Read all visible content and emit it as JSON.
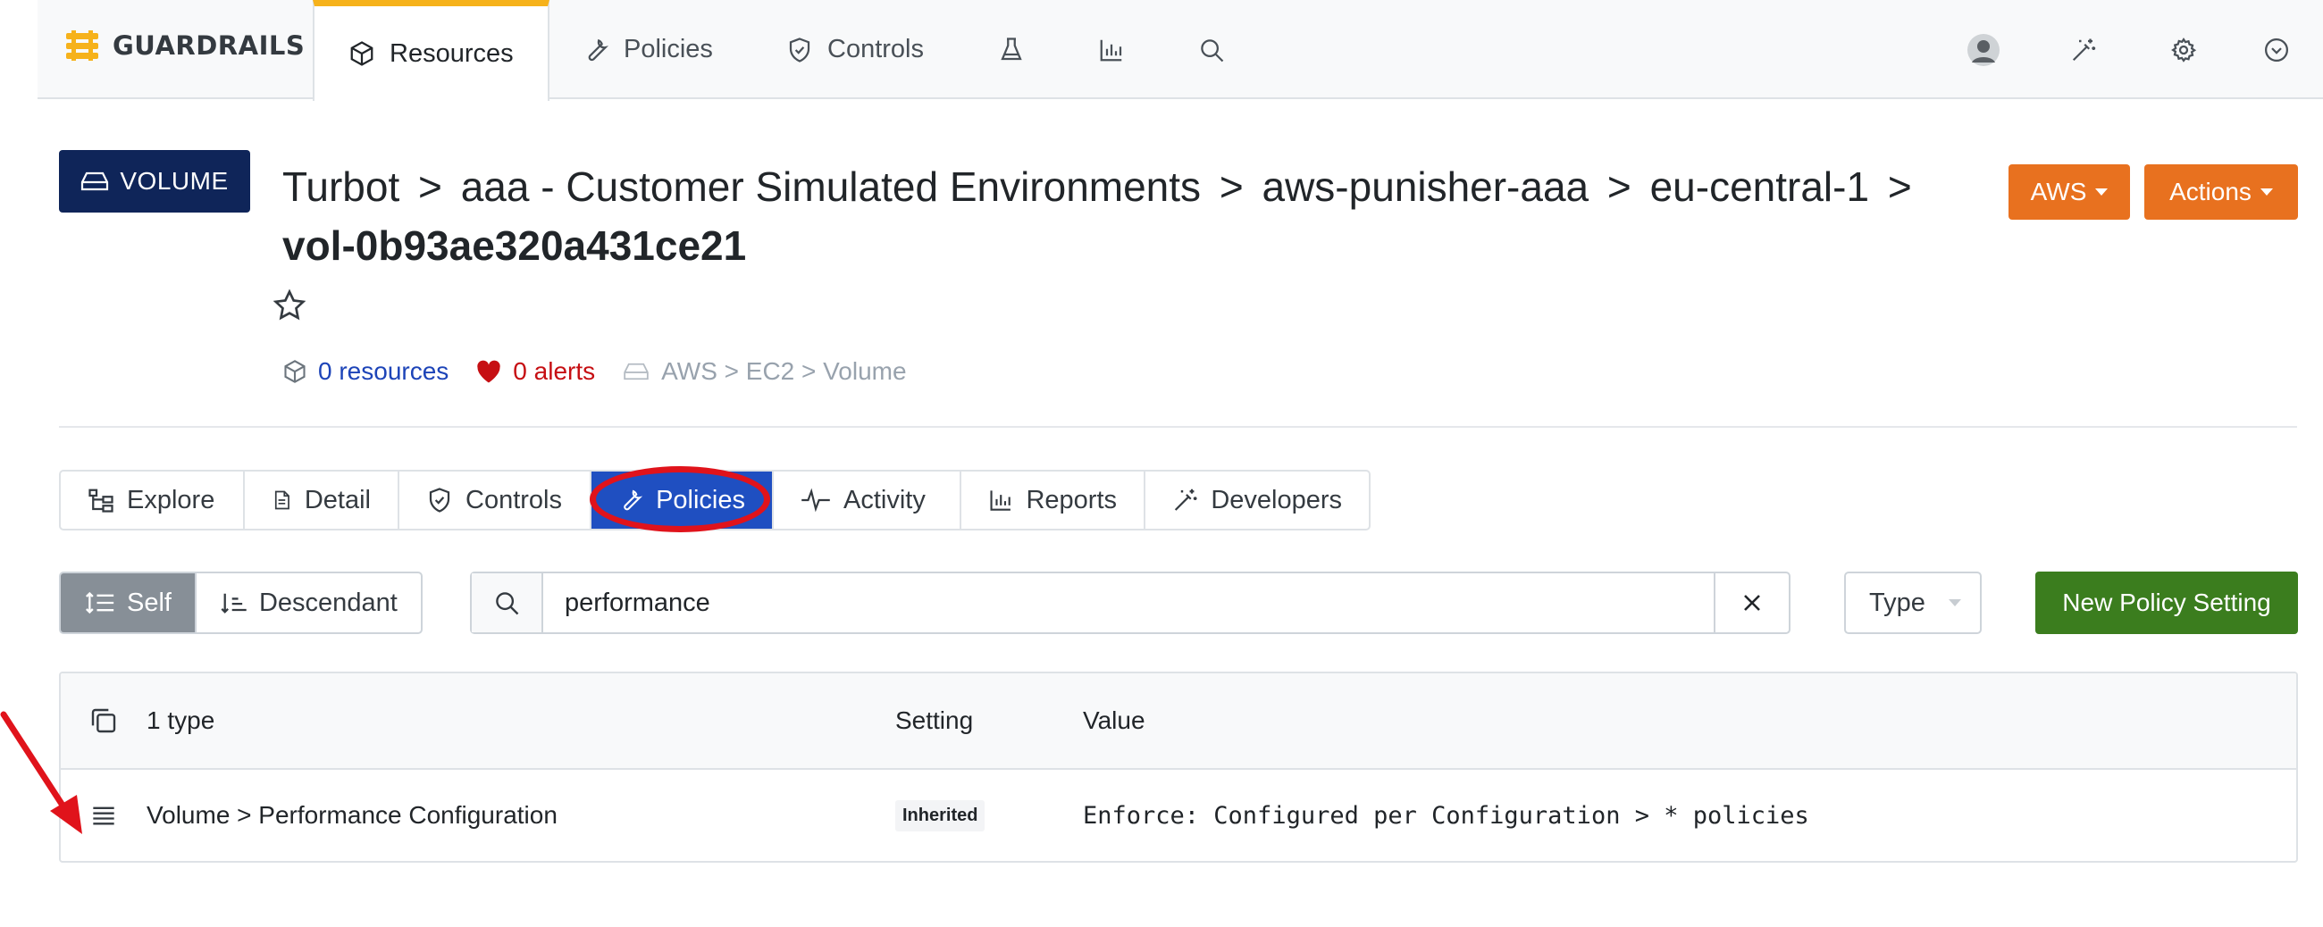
{
  "colors": {
    "brand_yellow": "#f6b21b",
    "badge_navy": "#0f2559",
    "action_orange": "#e8711f",
    "tab_active_blue": "#1f4fc1",
    "annotation_red": "#e0131b",
    "new_policy_green": "#3b7d1e",
    "link_blue": "#1d44b8",
    "alert_red": "#c60f13"
  },
  "topnav": {
    "brand": "GUARDRAILS",
    "items": [
      {
        "label": "Resources",
        "icon": "cube-icon"
      },
      {
        "label": "Policies",
        "icon": "wrench-icon"
      },
      {
        "label": "Controls",
        "icon": "shield-check-icon"
      }
    ],
    "icon_buttons": [
      "flask-icon",
      "bar-chart-icon",
      "search-icon"
    ],
    "right_icons": [
      "avatar",
      "magic-wand-icon",
      "gear-icon",
      "chevron-circle-down-icon"
    ]
  },
  "header": {
    "type_badge": "VOLUME",
    "breadcrumb": [
      "Turbot",
      "aaa - Customer Simulated Environments",
      "aws-punisher-aaa",
      "eu-central-1"
    ],
    "separator": ">",
    "resource_name": "vol-0b93ae320a431ce21",
    "resources_link": "0 resources",
    "alerts_link": "0 alerts",
    "resource_type": "AWS > EC2 > Volume",
    "aws_button": "AWS",
    "actions_button": "Actions"
  },
  "tabs": [
    {
      "label": "Explore",
      "icon": "hierarchy-icon"
    },
    {
      "label": "Detail",
      "icon": "document-icon"
    },
    {
      "label": "Controls",
      "icon": "shield-check-icon"
    },
    {
      "label": "Policies",
      "icon": "wrench-icon",
      "active": true
    },
    {
      "label": "Activity",
      "icon": "pulse-icon"
    },
    {
      "label": "Reports",
      "icon": "bar-chart-icon"
    },
    {
      "label": "Developers",
      "icon": "magic-wand-icon"
    }
  ],
  "filters": {
    "self_label": "Self",
    "descendant_label": "Descendant",
    "search_value": "performance",
    "type_label": "Type",
    "new_policy_label": "New Policy Setting"
  },
  "table": {
    "header": {
      "count": "1 type",
      "setting": "Setting",
      "value": "Value"
    },
    "rows": [
      {
        "name": "Volume > Performance Configuration",
        "setting": "Inherited",
        "value": "Enforce: Configured per Configuration > * policies"
      }
    ]
  }
}
